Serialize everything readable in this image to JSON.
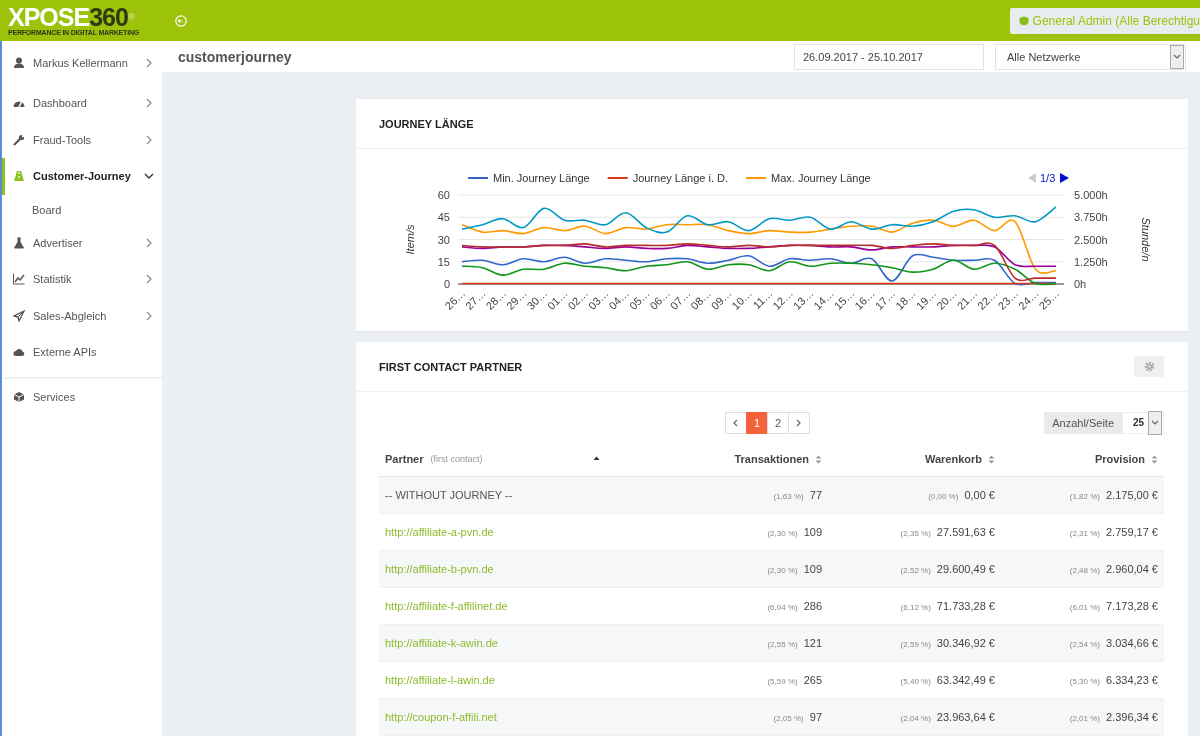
{
  "topbar": {
    "logo": {
      "part_a": "XPOSE",
      "part_b": "360",
      "mark": "®",
      "tagline": "PERFORMANCE IN DIGITAL MARKETING"
    },
    "role_button": "General Admin (Alle Berechtigu"
  },
  "sidebar": {
    "items": [
      {
        "label": "Markus Kellermann",
        "kind": "user",
        "selected": false,
        "expanded": false
      },
      {
        "label": "Dashboard",
        "kind": "menu",
        "selected": false,
        "expanded": false
      },
      {
        "label": "Fraud-Tools",
        "kind": "menu",
        "selected": false,
        "expanded": false
      },
      {
        "label": "Customer-Journey",
        "kind": "menu",
        "selected": true,
        "expanded": true,
        "children": [
          {
            "label": "Board"
          }
        ]
      },
      {
        "label": "Advertiser",
        "kind": "menu",
        "selected": false,
        "expanded": false
      },
      {
        "label": "Statistik",
        "kind": "menu",
        "selected": false,
        "expanded": false
      },
      {
        "label": "Sales-Abgleich",
        "kind": "menu",
        "selected": false,
        "expanded": false
      },
      {
        "label": "Externe APIs",
        "kind": "plain",
        "selected": false
      },
      {
        "label": "Services",
        "kind": "section",
        "selected": false
      }
    ]
  },
  "header": {
    "title": "customerjourney",
    "date_range": "26.09.2017 - 25.10.2017",
    "network_select": "Alle Netzwerke"
  },
  "journey_card": {
    "title": "JOURNEY LÄNGE",
    "legend_page": "1/3",
    "right_axis": {
      "label": "Stunde/n",
      "ticks": [
        "5.000h",
        "3.750h",
        "2.500h",
        "1.250h",
        "0h"
      ]
    },
    "chart_data": {
      "type": "line",
      "ylabel": "Item/s",
      "grid": true,
      "legend": "top",
      "ylim": [
        0,
        60
      ],
      "yticks": [
        0,
        15,
        30,
        45,
        60
      ],
      "categories": [
        "26…",
        "27…",
        "28…",
        "29…",
        "30…",
        "01…",
        "02…",
        "03…",
        "04…",
        "05…",
        "06…",
        "07…",
        "08…",
        "09…",
        "10…",
        "11…",
        "12…",
        "13…",
        "14…",
        "15…",
        "16…",
        "17…",
        "18…",
        "19…",
        "20…",
        "21…",
        "22…",
        "23…",
        "24…",
        "25…"
      ],
      "series": [
        {
          "name": "Min. Journey Länge",
          "color": "#3366cc",
          "values": [
            15,
            16,
            13,
            17,
            15,
            18,
            14,
            17,
            16,
            15,
            17,
            17,
            14,
            16,
            19,
            12,
            17,
            16,
            17,
            14,
            17,
            2,
            19,
            18,
            16,
            16,
            16,
            0,
            1,
            1
          ]
        },
        {
          "name": "Journey Länge i. D.",
          "color": "#dc3912",
          "values": [
            0,
            0,
            0,
            0,
            0,
            0,
            0,
            0,
            0,
            0,
            0,
            0,
            0,
            0,
            0,
            0,
            0,
            0,
            0,
            0,
            0,
            0,
            0,
            0,
            0,
            0,
            0,
            0,
            0,
            0
          ]
        },
        {
          "name": "Max. Journey Länge",
          "color": "#ff9900",
          "values": [
            40,
            35,
            36,
            34,
            38,
            36,
            39,
            34,
            38,
            37,
            40,
            40,
            40,
            36,
            34,
            36,
            35,
            35,
            37,
            39,
            39,
            35,
            41,
            43,
            39,
            43,
            36,
            42,
            10,
            9
          ]
        },
        {
          "color": "#109618",
          "values": [
            12,
            11,
            6,
            10,
            10,
            14,
            12,
            11,
            9,
            12,
            13,
            15,
            10,
            13,
            13,
            9,
            15,
            12,
            14,
            14,
            13,
            11,
            8,
            10,
            16,
            10,
            14,
            10,
            0,
            0
          ]
        },
        {
          "color": "#990099",
          "values": [
            25,
            24,
            25,
            25,
            26,
            26,
            25,
            24,
            25,
            24,
            24,
            26,
            25,
            24,
            24,
            25,
            26,
            26,
            25,
            25,
            23,
            25,
            25,
            25,
            26,
            26,
            25,
            13,
            12,
            12
          ]
        },
        {
          "color": "#0099c6",
          "values": [
            37,
            40,
            44,
            38,
            51,
            43,
            43,
            40,
            48,
            38,
            35,
            46,
            40,
            42,
            36,
            44,
            43,
            45,
            37,
            42,
            37,
            40,
            39,
            42,
            49,
            50,
            45,
            46,
            42,
            52
          ]
        },
        {
          "color": "#b82e2e",
          "values": [
            26,
            25,
            25,
            25,
            26,
            26,
            27,
            25,
            26,
            26,
            26,
            27,
            26,
            25,
            26,
            25,
            26,
            26,
            26,
            26,
            26,
            24,
            26,
            27,
            26,
            26,
            26,
            4,
            4,
            4
          ]
        }
      ]
    }
  },
  "partner_card": {
    "title": "FIRST CONTACT PARTNER",
    "pagination": {
      "pages": [
        {
          "label": "1",
          "selected": true
        },
        {
          "label": "2",
          "selected": false
        }
      ]
    },
    "per_page": {
      "label": "Anzahl/Seite",
      "value": "25"
    },
    "columns": [
      {
        "label": "Partner",
        "note": "(first contact)",
        "sorted": true
      },
      {
        "label": "Transaktionen",
        "sorted": false
      },
      {
        "label": "Warenkorb",
        "sorted": false
      },
      {
        "label": "Provision",
        "sorted": false
      }
    ],
    "rows": [
      {
        "kind": "label",
        "cells": [
          {
            "text": "-- WITHOUT JOURNEY --"
          },
          {
            "share": "(1,63 %)",
            "value": "77"
          },
          {
            "share": "(0,00 %)",
            "value": "0,00 €"
          },
          {
            "share": "(1,82 %)",
            "value": "2.175,00 €"
          }
        ]
      },
      {
        "kind": "link",
        "cells": [
          {
            "text": "http://affiliate-a-pvn.de"
          },
          {
            "share": "(2,30 %)",
            "value": "109"
          },
          {
            "share": "(2,35 %)",
            "value": "27.591,63 €"
          },
          {
            "share": "(2,31 %)",
            "value": "2.759,17 €"
          }
        ]
      },
      {
        "kind": "link",
        "cells": [
          {
            "text": "http://affiliate-b-pvn.de"
          },
          {
            "share": "(2,30 %)",
            "value": "109"
          },
          {
            "share": "(2,52 %)",
            "value": "29.600,49 €"
          },
          {
            "share": "(2,48 %)",
            "value": "2.960,04 €"
          }
        ]
      },
      {
        "kind": "link",
        "cells": [
          {
            "text": "http://affiliate-f-affilinet.de"
          },
          {
            "share": "(6,04 %)",
            "value": "286"
          },
          {
            "share": "(6,12 %)",
            "value": "71.733,28 €"
          },
          {
            "share": "(6,01 %)",
            "value": "7.173,28 €"
          }
        ]
      },
      {
        "kind": "link",
        "cells": [
          {
            "text": "http://affiliate-k-awin.de"
          },
          {
            "share": "(2,55 %)",
            "value": "121"
          },
          {
            "share": "(2,59 %)",
            "value": "30.346,92 €"
          },
          {
            "share": "(2,54 %)",
            "value": "3.034,66 €"
          }
        ]
      },
      {
        "kind": "link",
        "cells": [
          {
            "text": "http://affiliate-l-awin.de"
          },
          {
            "share": "(5,59 %)",
            "value": "265"
          },
          {
            "share": "(5,40 %)",
            "value": "63.342,49 €"
          },
          {
            "share": "(5,30 %)",
            "value": "6.334,23 €"
          }
        ]
      },
      {
        "kind": "link",
        "cells": [
          {
            "text": "http://coupon-f-affili.net"
          },
          {
            "share": "(2,05 %)",
            "value": "97"
          },
          {
            "share": "(2,04 %)",
            "value": "23.963,64 €"
          },
          {
            "share": "(2,01 %)",
            "value": "2.396,34 €"
          }
        ]
      }
    ]
  }
}
